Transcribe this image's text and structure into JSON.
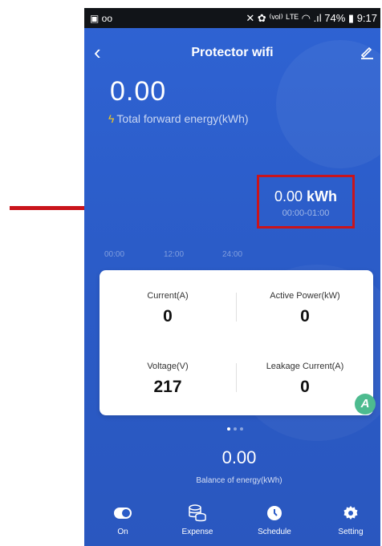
{
  "status_bar": {
    "left_icons": "▣ ᴏᴏ",
    "right": "✕ ✿ ⁽ᵛᵒˡ⁾ ᴸᵀᴱ ◠ .ıl 74% ▮ 9:17"
  },
  "header": {
    "title": "Protector wifi"
  },
  "summary": {
    "total_value": "0.00",
    "total_label": "Total forward energy(kWh)"
  },
  "highlight": {
    "value": "0.00",
    "unit": "kWh",
    "range": "00:00-01:00"
  },
  "time_axis": [
    "00:00",
    "12:00",
    "24:00"
  ],
  "metrics": {
    "current_label": "Current(A)",
    "current_value": "0",
    "active_power_label": "Active Power(kW)",
    "active_power_value": "0",
    "voltage_label": "Voltage(V)",
    "voltage_value": "217",
    "leakage_label": "Leakage Current(A)",
    "leakage_value": "0"
  },
  "badge": "A",
  "balance": {
    "value": "0.00",
    "label": "Balance of energy(kWh)"
  },
  "tabs": [
    {
      "label": "On",
      "icon": "toggle-icon"
    },
    {
      "label": "Expense",
      "icon": "coins-icon"
    },
    {
      "label": "Schedule",
      "icon": "clock-icon"
    },
    {
      "label": "Setting",
      "icon": "gear-icon"
    }
  ],
  "colors": {
    "background": "#2b5cc8",
    "status_bar": "#111418",
    "annotation": "#c9141b",
    "bolt": "#f5c81f",
    "badge": "#4dbb8f"
  }
}
